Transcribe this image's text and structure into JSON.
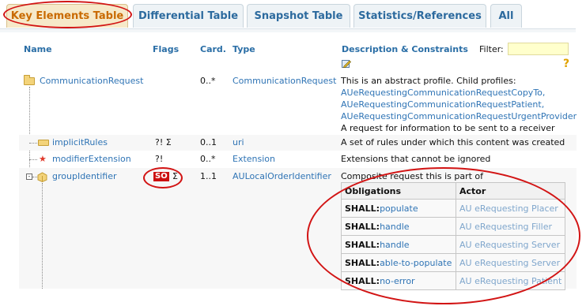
{
  "tabs": [
    {
      "label": "Key Elements Table",
      "active": true
    },
    {
      "label": "Differential Table",
      "active": false
    },
    {
      "label": "Snapshot Table",
      "active": false
    },
    {
      "label": "Statistics/References",
      "active": false
    },
    {
      "label": "All",
      "active": false
    }
  ],
  "headers": {
    "name": "Name",
    "flags": "Flags",
    "card": "Card.",
    "type": "Type",
    "desc": "Description & Constraints",
    "filter_label": "Filter:",
    "filter_value": ""
  },
  "help_icon": "?",
  "rows": [
    {
      "name": "CommunicationRequest",
      "flags": "",
      "card": "0..*",
      "type": "CommunicationRequest",
      "desc_lines": [
        "This is an abstract profile. Child profiles:",
        "AUeRequestingCommunicationRequestCopyTo,",
        "AUeRequestingCommunicationRequestPatient,",
        "AUeRequestingCommunicationRequestUrgentProvider",
        "A request for information to be sent to a receiver"
      ]
    },
    {
      "name": "implicitRules",
      "flags": "?! Σ",
      "card": "0..1",
      "type": "uri",
      "desc": "A set of rules under which this content was created"
    },
    {
      "name": "modifierExtension",
      "flags": "?!",
      "card": "0..*",
      "type": "Extension",
      "desc": "Extensions that cannot be ignored"
    },
    {
      "name": "groupIdentifier",
      "flag_so": "SO",
      "flags_sigma": "Σ",
      "card": "1..1",
      "type": "AULocalOrderIdentifier",
      "desc": "Composite request this is part of"
    }
  ],
  "obligations": {
    "headers": [
      "Obligations",
      "Actor"
    ],
    "rows": [
      {
        "shall": "SHALL:",
        "verb": "populate",
        "actor": "AU eRequesting Placer"
      },
      {
        "shall": "SHALL:",
        "verb": "handle",
        "actor": "AU eRequesting Filler"
      },
      {
        "shall": "SHALL:",
        "verb": "handle",
        "actor": "AU eRequesting Server"
      },
      {
        "shall": "SHALL:",
        "verb": "able-to-populate",
        "actor": "AU eRequesting Server"
      },
      {
        "shall": "SHALL:",
        "verb": "no-error",
        "actor": "AU eRequesting Patient"
      }
    ]
  },
  "colors": {
    "accent_link": "#2f74b5",
    "annotation_red": "#d21414",
    "active_tab_text": "#c96a00"
  }
}
